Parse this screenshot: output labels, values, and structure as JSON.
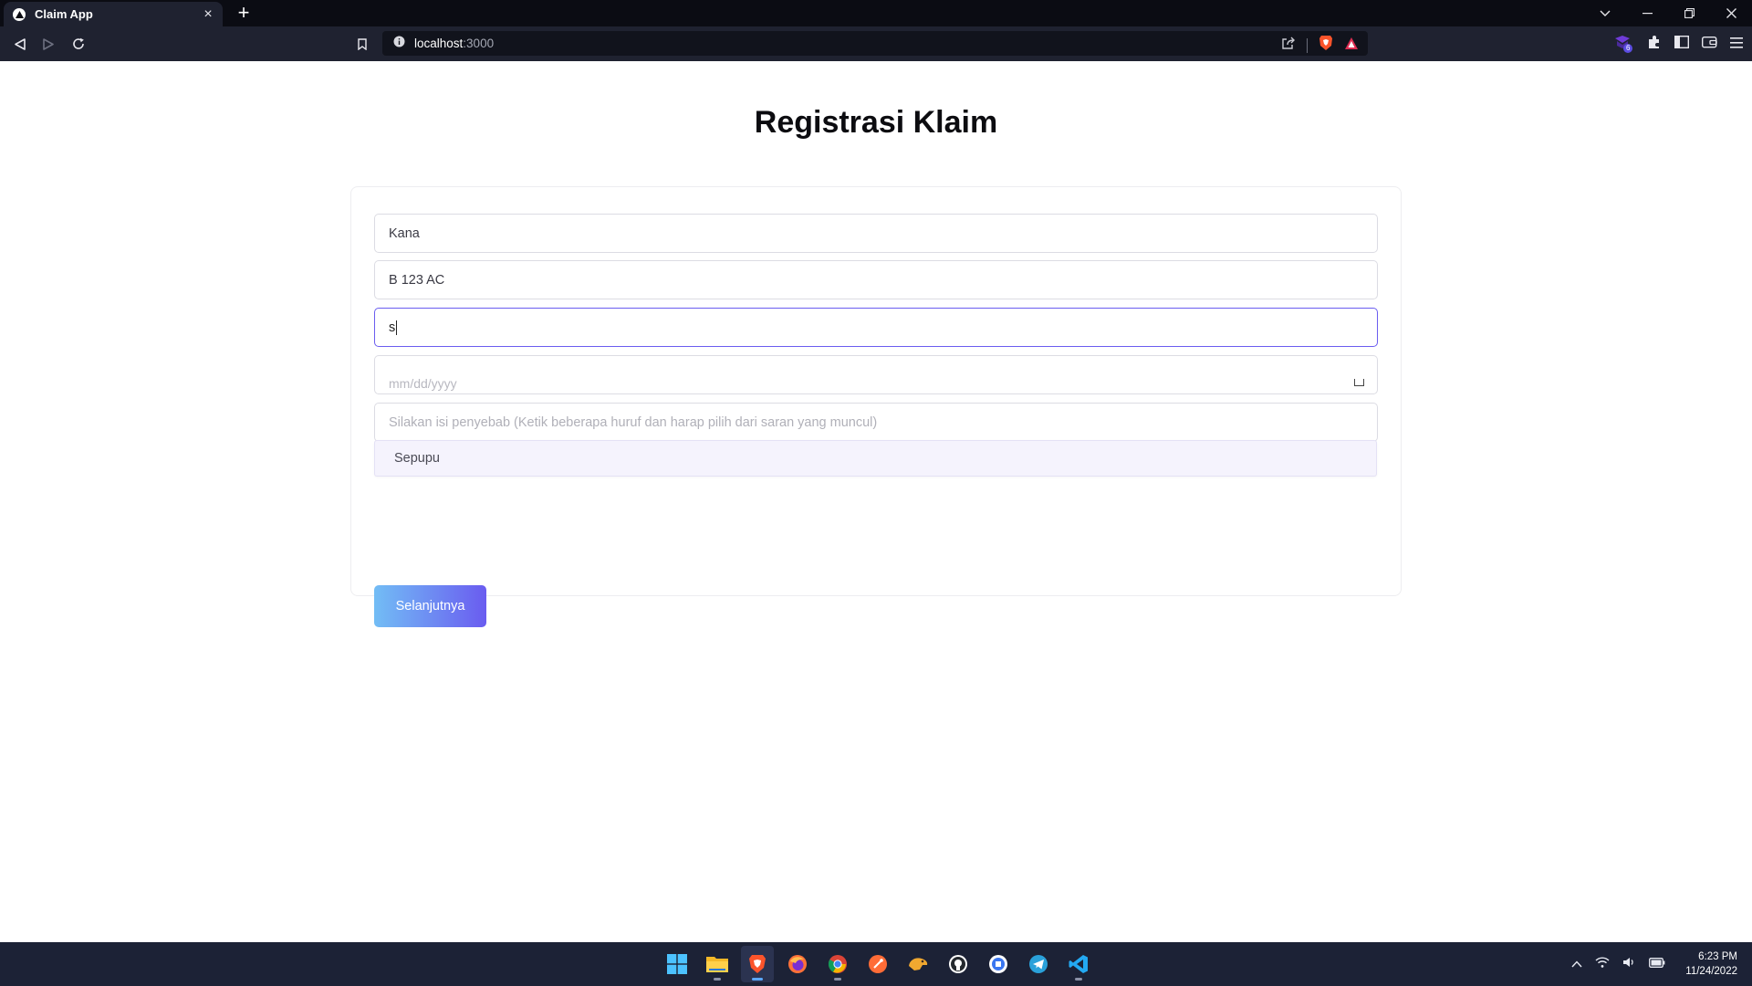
{
  "browser": {
    "tab_title": "Claim App",
    "url_host": "localhost",
    "url_port": ":3000",
    "extension_badge": "6"
  },
  "page": {
    "title": "Registrasi Klaim"
  },
  "form": {
    "name_value": "Kana",
    "plate_value": "B 123 AC",
    "relation_value": "s",
    "date_mask": "mm/dd/yyyy",
    "cause_placeholder": "Silakan isi penyebab (Ketik beberapa huruf dan harap pilih dari saran yang muncul)",
    "suggestion": "Sepupu",
    "next_label": "Selanjutnya"
  },
  "taskbar": {
    "time": "6:23 PM",
    "date": "11/24/2022",
    "apps": [
      "windows-start",
      "file-explorer",
      "brave",
      "firefox",
      "chrome",
      "postman",
      "dbeaver",
      "github-desktop",
      "signal",
      "telegram",
      "vscode"
    ]
  },
  "colors": {
    "accent": "#6a5df0",
    "button_gradient_start": "#72bdf5",
    "button_gradient_end": "#6a5cf0",
    "suggestion_bg": "#f5f3fd",
    "taskbar_bg": "#1c2236"
  }
}
